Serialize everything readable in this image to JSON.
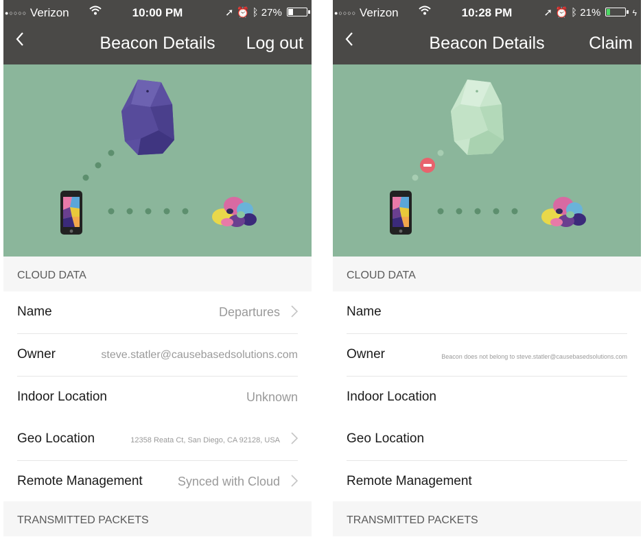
{
  "screens": [
    {
      "status": {
        "carrier": "Verizon",
        "time": "10:00 PM",
        "battery": "27%",
        "battery_level": 0.27
      },
      "nav": {
        "title": "Beacon Details",
        "action": "Log out"
      },
      "beacon_color": "#5b4fa0",
      "beacon_shade": "#4a3f8c",
      "sections": {
        "cloud": "CLOUD DATA",
        "packets": "TRANSMITTED PACKETS"
      },
      "rows": {
        "name": {
          "label": "Name",
          "value": "Departures"
        },
        "owner": {
          "label": "Owner",
          "value": "steve.statler@causebasedsolutions.com"
        },
        "indoor": {
          "label": "Indoor Location",
          "value": "Unknown"
        },
        "geo": {
          "label": "Geo Location",
          "value": "12358 Reata Ct, San Diego, CA 92128, USA"
        },
        "remote": {
          "label": "Remote Management",
          "value": "Synced with Cloud"
        }
      }
    },
    {
      "status": {
        "carrier": "Verizon",
        "time": "10:28 PM",
        "battery": "21%",
        "battery_level": 0.21
      },
      "nav": {
        "title": "Beacon Details",
        "action": "Claim"
      },
      "beacon_color": "#c9e6cd",
      "beacon_shade": "#b3d9b9",
      "sections": {
        "cloud": "CLOUD DATA",
        "packets": "TRANSMITTED PACKETS"
      },
      "rows": {
        "name": {
          "label": "Name",
          "value": ""
        },
        "owner": {
          "label": "Owner",
          "value": "Beacon does not belong to steve.statler@causebasedsolutions.com"
        },
        "indoor": {
          "label": "Indoor Location",
          "value": ""
        },
        "geo": {
          "label": "Geo Location",
          "value": ""
        },
        "remote": {
          "label": "Remote Management",
          "value": ""
        }
      }
    }
  ],
  "colors": {
    "nav_bar": "#4a4947",
    "hero_bg": "#8bb69b",
    "section_bg": "#f6f6f6",
    "blocked": "#e8636d"
  },
  "icons": {
    "back": "chevron-left-icon",
    "row": "chevron-right-icon",
    "wifi": "wifi-icon",
    "location": "location-arrow-icon",
    "alarm": "alarm-icon",
    "bluetooth": "bluetooth-icon"
  }
}
